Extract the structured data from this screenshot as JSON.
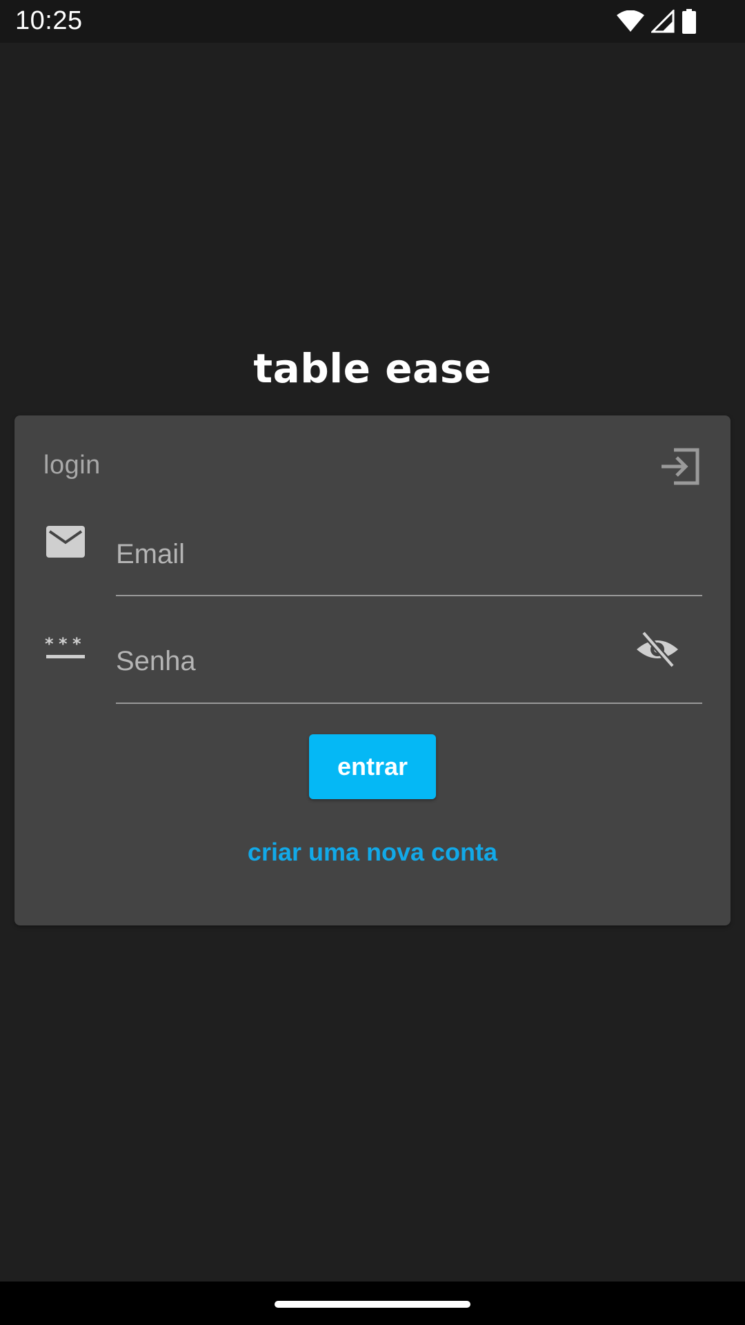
{
  "status_bar": {
    "time": "10:25",
    "icons": [
      "wifi-icon",
      "signal-icon",
      "battery-icon"
    ]
  },
  "app": {
    "title": "table ease"
  },
  "login_card": {
    "heading": "login",
    "heading_icon": "login-icon",
    "email": {
      "icon": "email-icon",
      "placeholder": "Email",
      "value": ""
    },
    "password": {
      "icon": "password-icon",
      "placeholder": "Senha",
      "value": "",
      "toggle_icon": "visibility-off-icon"
    },
    "submit_label": "entrar",
    "create_account_label": "criar uma nova conta"
  },
  "colors": {
    "background": "#1f1f1f",
    "card": "#444444",
    "accent": "#05b8f5",
    "link": "#12a9e8"
  }
}
